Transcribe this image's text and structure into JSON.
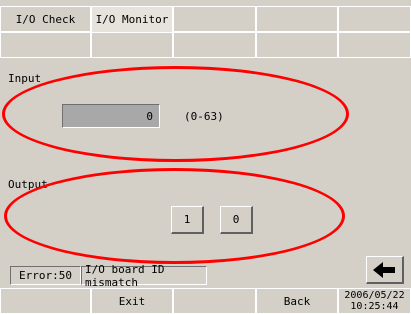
{
  "tabs": [
    {
      "label": "I/O Check"
    },
    {
      "label": "I/O Monitor"
    }
  ],
  "input": {
    "label": "Input",
    "value": "0",
    "range": "(0-63)"
  },
  "output": {
    "label": "Output",
    "button1": "1",
    "button2": "0"
  },
  "status": {
    "code": "Error:50",
    "message": "I/O board ID mismatch"
  },
  "footer": {
    "exit_label": "Exit",
    "back_label": "Back",
    "date": "2006/05/22",
    "time": "10:25:44"
  },
  "icons": {
    "back_arrow": "left-arrow-icon"
  },
  "colors": {
    "highlight_ellipse": "#ff0000",
    "panel_bg": "#d4d0c8",
    "field_bg": "#a8a8a8"
  }
}
